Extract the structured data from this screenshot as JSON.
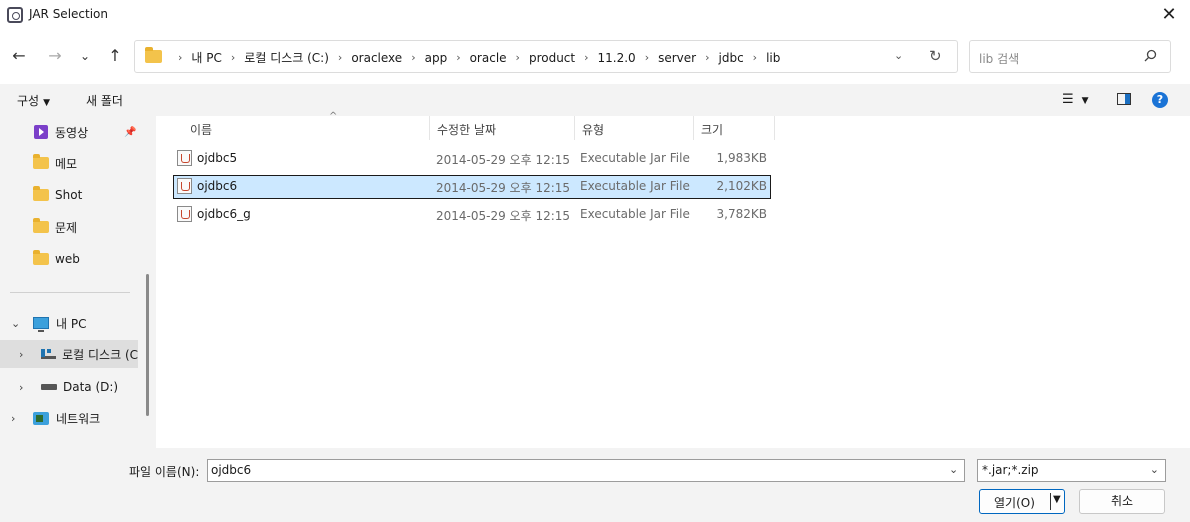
{
  "window": {
    "title": "JAR Selection"
  },
  "nav": {
    "breadcrumb": [
      "내 PC",
      "로컬 디스크 (C:)",
      "oraclexe",
      "app",
      "oracle",
      "product",
      "11.2.0",
      "server",
      "jdbc",
      "lib"
    ],
    "search_placeholder": "lib 검색"
  },
  "toolbar": {
    "organize_label": "구성",
    "new_folder_label": "새 폴더"
  },
  "sidebar": {
    "items": [
      {
        "label": "동영상",
        "icon": "video-icon",
        "pinned": true
      },
      {
        "label": "메모",
        "icon": "folder-icon"
      },
      {
        "label": "Shot",
        "icon": "folder-icon"
      },
      {
        "label": "문제",
        "icon": "folder-icon"
      },
      {
        "label": "web",
        "icon": "folder-icon"
      },
      {
        "label": "내 PC",
        "icon": "pc-icon",
        "expanded": true
      },
      {
        "label": "로컬 디스크 (C",
        "icon": "drive-icon",
        "selected": true
      },
      {
        "label": "Data (D:)",
        "icon": "drive-icon"
      },
      {
        "label": "네트워크",
        "icon": "network-icon"
      }
    ]
  },
  "list": {
    "columns": [
      "이름",
      "수정한 날짜",
      "유형",
      "크기"
    ],
    "rows": [
      {
        "name": "ojdbc5",
        "date": "2014-05-29 오후 12:15",
        "type": "Executable Jar File",
        "size": "1,983KB",
        "selected": false
      },
      {
        "name": "ojdbc6",
        "date": "2014-05-29 오후 12:15",
        "type": "Executable Jar File",
        "size": "2,102KB",
        "selected": true
      },
      {
        "name": "ojdbc6_g",
        "date": "2014-05-29 오후 12:15",
        "type": "Executable Jar File",
        "size": "3,782KB",
        "selected": false
      }
    ]
  },
  "footer": {
    "filename_label": "파일 이름(N):",
    "filename_value": "ojdbc6",
    "filetype_value": "*.jar;*.zip",
    "open_label": "열기(O)",
    "cancel_label": "취소"
  },
  "colors": {
    "selection": "#cce8ff",
    "folder": "#f3c34b",
    "accent": "#0067c0"
  }
}
